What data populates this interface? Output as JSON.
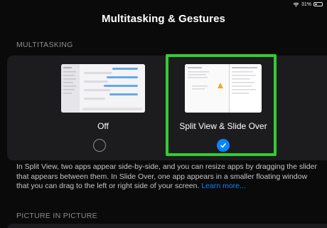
{
  "status": {
    "battery_text": "31%",
    "battery_level": 0.31,
    "icons": [
      "wifi-icon",
      "battery-icon"
    ]
  },
  "header": {
    "title": "Multitasking & Gestures"
  },
  "multitasking": {
    "section_title": "MULTITASKING",
    "options": [
      {
        "label": "Off",
        "selected": false
      },
      {
        "label": "Split View & Slide Over",
        "selected": true
      }
    ],
    "description": "In Split View, two apps appear side-by-side, and you can resize apps by dragging the slider that appears between them. In Slide Over, one app appears in a smaller floating window that you can drag to the left or right side of your screen.",
    "learn_more": "Learn more..."
  },
  "pip": {
    "section_title": "PICTURE IN PICTURE"
  },
  "colors": {
    "accent": "#0a84ff",
    "highlight": "#33cc33",
    "background": "#0a0a0a",
    "card": "#1c1c1e",
    "secondary_text": "#8e8e93"
  }
}
